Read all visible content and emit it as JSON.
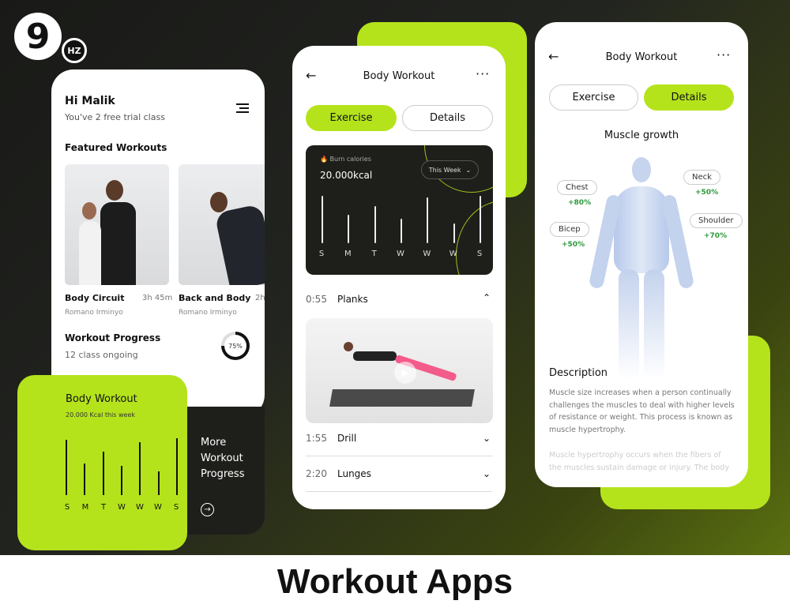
{
  "brand": {
    "logo_main": "9",
    "logo_sub": "HZ"
  },
  "footer_title": "Workout Apps",
  "colors": {
    "accent": "#b4e31c",
    "dark": "#1e1f1b"
  },
  "phone1": {
    "greeting": "Hi Malik",
    "subtitle": "You've 2 free trial class",
    "menu_icon": "menu-icon",
    "featured_title": "Featured Workouts",
    "workouts": [
      {
        "title": "Body Circuit",
        "duration": "3h 45m",
        "trainer": "Romano Irminyo"
      },
      {
        "title": "Back and Body",
        "duration": "2h",
        "trainer": "Romano Irminyo"
      }
    ],
    "progress_title": "Workout Progress",
    "progress_sub": "12 class ongoing",
    "progress_percent": 75,
    "progress_label": "75%",
    "card": {
      "title": "Body Workout",
      "subtitle": "20.000 Kcal this week",
      "days": [
        "S",
        "M",
        "T",
        "W",
        "W",
        "W",
        "S"
      ],
      "values": [
        70,
        40,
        55,
        37,
        67,
        30,
        72
      ]
    },
    "more": {
      "line1": "More",
      "line2": "Workout",
      "line3": "Progress"
    }
  },
  "phone2": {
    "title": "Body Workout",
    "tabs": [
      "Exercise",
      "Details"
    ],
    "active_tab": 0,
    "burn_label": "Burn calories",
    "calories": "20.000kcal",
    "period": "This Week",
    "days": [
      "S",
      "M",
      "T",
      "W",
      "W",
      "W",
      "S"
    ],
    "values": [
      58,
      35,
      45,
      30,
      56,
      24,
      58
    ],
    "exercises": [
      {
        "time": "0:55",
        "name": "Planks",
        "expanded": true
      },
      {
        "time": "1:55",
        "name": "Drill"
      },
      {
        "time": "2:20",
        "name": "Lunges"
      }
    ]
  },
  "phone3": {
    "title": "Body Workout",
    "tabs": [
      "Exercise",
      "Details"
    ],
    "active_tab": 1,
    "section": "Muscle growth",
    "muscles": [
      {
        "name": "Chest",
        "value": "+80%"
      },
      {
        "name": "Neck",
        "value": "+50%"
      },
      {
        "name": "Bicep",
        "value": "+50%"
      },
      {
        "name": "Shoulder",
        "value": "+70%"
      }
    ],
    "description_title": "Description",
    "description": "Muscle size increases when a person continually challenges the muscles to deal with higher levels of resistance or weight. This process is known as muscle hypertrophy.",
    "description2": "Muscle hypertrophy occurs when the fibers of the muscles sustain damage or injury. The body"
  }
}
